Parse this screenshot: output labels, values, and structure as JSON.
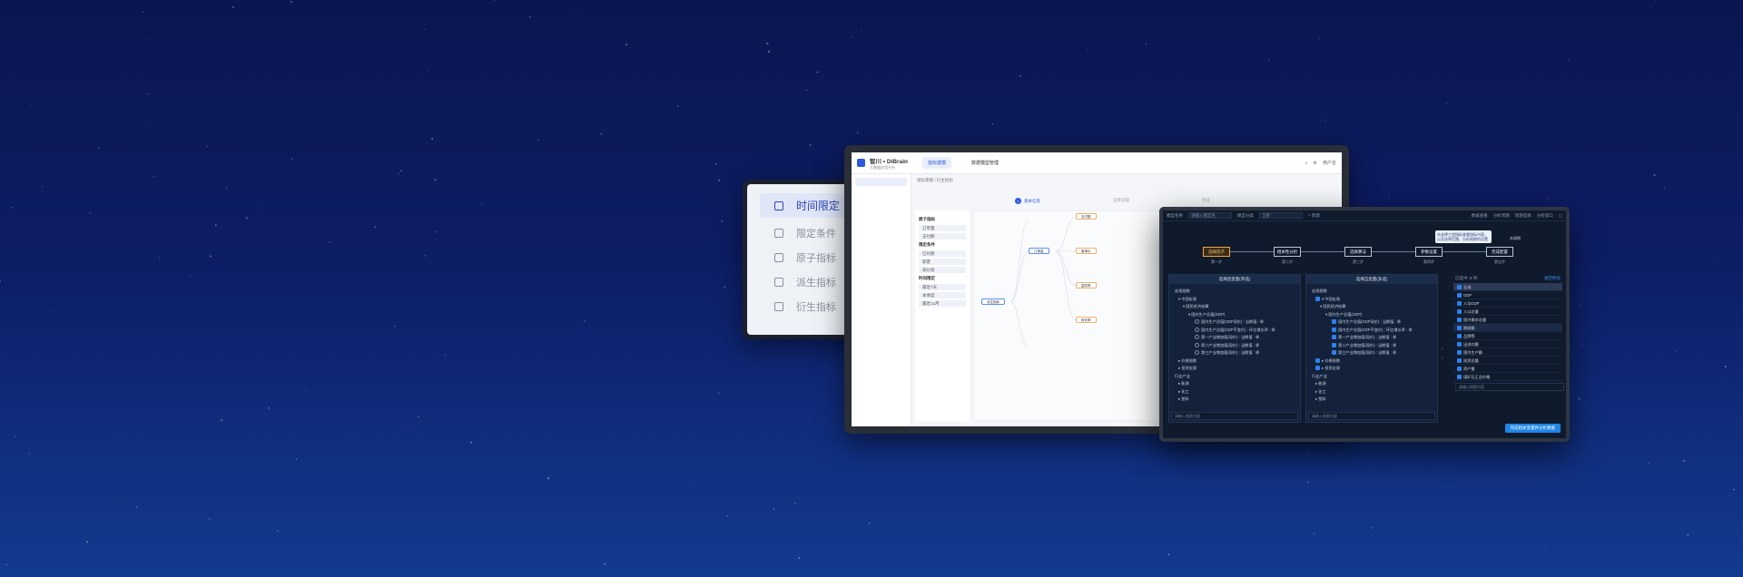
{
  "colors": {
    "accent": "#2b59d9",
    "highlight": "#f0a640",
    "dark_bg": "#0f1b2c",
    "page_bg": "#0d1d66"
  },
  "menu": {
    "items": [
      {
        "label": "时间限定",
        "icon": "grid-icon",
        "active": true
      },
      {
        "label": "限定条件",
        "icon": "document-icon",
        "active": false
      },
      {
        "label": "原子指标",
        "icon": "tag-icon",
        "active": false
      },
      {
        "label": "派生指标",
        "icon": "clock-icon",
        "active": false
      },
      {
        "label": "衍生指标",
        "icon": "export-icon",
        "active": false
      }
    ]
  },
  "app": {
    "brand_title": "智川 • DiBrain",
    "brand_sub": "大数据应用平台",
    "nav_tabs": [
      "指标建模",
      "数据模型管理"
    ],
    "user": "用户名",
    "breadcrumb": "指标建模 / 衍生指标",
    "steps": [
      "基本信息",
      "运算逻辑",
      "完成"
    ],
    "step_number": "1",
    "run_label": "运行预览",
    "left_panel": {
      "sections": [
        {
          "title": "原子指标",
          "items": [
            "订单量",
            "支付额"
          ]
        },
        {
          "title": "限定条件",
          "items": [
            "已付款",
            "新客",
            "高价值"
          ]
        },
        {
          "title": "时间限定",
          "items": [
            "最近7天",
            "本季度",
            "最近12月"
          ]
        }
      ]
    },
    "nodes": [
      "派生指标",
      "订单量",
      "支付额",
      "客单价",
      "复购率",
      "转化率"
    ]
  },
  "dark": {
    "toolbar": {
      "model_label": "模型名称",
      "model_placeholder": "请输入模型名",
      "type_label": "模型分类",
      "type_value": "全部",
      "new_label": "+ 新建",
      "data_label": "数据查看",
      "hint_label": "分析周期",
      "pattern_label": "周期选择",
      "window_label": "分析窗口"
    },
    "tooltip": "先选择工程指标查看指标内容，以及选择范围，分析周期的设置",
    "flow": [
      {
        "label": "选择因子",
        "step": "第一步",
        "active": true
      },
      {
        "label": "相关性分析",
        "step": "第二步",
        "active": false
      },
      {
        "label": "选择算法",
        "step": "第三步",
        "active": false
      },
      {
        "label": "参数设置",
        "step": "第四步",
        "active": false
      },
      {
        "label": "完成配置",
        "step": "第五步",
        "active": false
      }
    ],
    "month_label": "本周期",
    "panel_a": {
      "title": "选择因变量(单选)",
      "tree": [
        {
          "t": "宏观指数",
          "lvl": 0,
          "cb": ""
        },
        {
          "t": "▾ 中国宏观",
          "lvl": 1,
          "cb": ""
        },
        {
          "t": "▾ 国民经济核算",
          "lvl": 2,
          "cb": ""
        },
        {
          "t": "▾ 国内生产总值(GDP)",
          "lvl": 3,
          "cb": ""
        },
        {
          "t": "国内生产总值(GDP现价) : 当期值 : 季",
          "lvl": 4,
          "cb": "radio"
        },
        {
          "t": "国内生产总值(GDP不变价) : 环比增长率 : 季",
          "lvl": 4,
          "cb": "radio"
        },
        {
          "t": "第一产业增加值(现价) : 当期值 : 季",
          "lvl": 4,
          "cb": "radio"
        },
        {
          "t": "第二产业增加值(现价) : 当期值 : 季",
          "lvl": 4,
          "cb": "radio"
        },
        {
          "t": "第三产业增加值(现价) : 当期值 : 季",
          "lvl": 4,
          "cb": "radio"
        },
        {
          "t": "▸ 价格指数",
          "lvl": 1,
          "cb": ""
        },
        {
          "t": "▸ 投资宏观",
          "lvl": 1,
          "cb": ""
        },
        {
          "t": "行业产业",
          "lvl": 0,
          "cb": ""
        },
        {
          "t": "▸ 能源",
          "lvl": 1,
          "cb": ""
        },
        {
          "t": "▸ 化工",
          "lvl": 1,
          "cb": ""
        },
        {
          "t": "▸ 塑料",
          "lvl": 1,
          "cb": ""
        }
      ],
      "search": "请输入搜索内容"
    },
    "panel_b": {
      "title": "选择自变量(多选)",
      "tree": [
        {
          "t": "宏观指数",
          "lvl": 0,
          "cb": ""
        },
        {
          "t": "▾ 中国宏观",
          "lvl": 1,
          "cb": "on"
        },
        {
          "t": "▾ 国民经济核算",
          "lvl": 2,
          "cb": ""
        },
        {
          "t": "▾ 国内生产总值(GDP)",
          "lvl": 3,
          "cb": ""
        },
        {
          "t": "国内生产总值(GDP现价) : 当期值 : 季",
          "lvl": 4,
          "cb": "on"
        },
        {
          "t": "国内生产总值(GDP不变价) : 环比增长率 : 季",
          "lvl": 4,
          "cb": "on"
        },
        {
          "t": "第一产业增加值(现价) : 当期值 : 季",
          "lvl": 4,
          "cb": "on"
        },
        {
          "t": "第二产业增加值(现价) : 当期值 : 季",
          "lvl": 4,
          "cb": "on"
        },
        {
          "t": "第三产业增加值(现价) : 当期值 : 季",
          "lvl": 4,
          "cb": "on"
        },
        {
          "t": "▸ 价格指数",
          "lvl": 1,
          "cb": "on"
        },
        {
          "t": "▸ 投资宏观",
          "lvl": 1,
          "cb": "on"
        },
        {
          "t": "行业产业",
          "lvl": 0,
          "cb": ""
        },
        {
          "t": "▸ 能源",
          "lvl": 1,
          "cb": ""
        },
        {
          "t": "▸ 化工",
          "lvl": 1,
          "cb": ""
        },
        {
          "t": "▸ 塑料",
          "lvl": 1,
          "cb": ""
        }
      ],
      "search": "请输入搜索内容"
    },
    "selected": {
      "head": "已选中: 9 项",
      "clear": "清空所有",
      "items": [
        "全选",
        "GDP",
        "人均GDP",
        "人口总量",
        "国内需求总量",
        "税收额",
        "品牌等",
        "出进口额",
        "国内生产额",
        "投资总量",
        "资产量",
        "煤矿石汇总价格"
      ],
      "search": "请输入搜索内容"
    },
    "submit": "完成相关变量并分析数据"
  }
}
